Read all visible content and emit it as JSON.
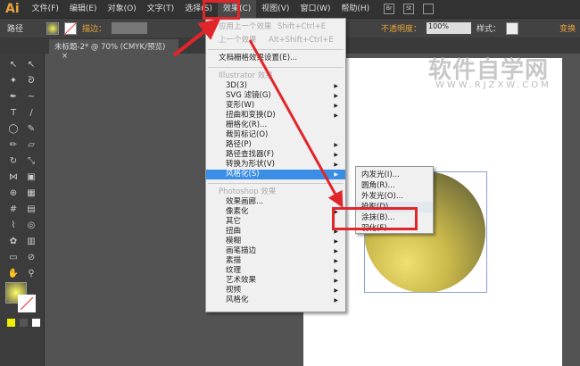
{
  "app": {
    "logo": "Ai"
  },
  "menubar": [
    "文件(F)",
    "编辑(E)",
    "对象(O)",
    "文字(T)",
    "选择(S)",
    "效果(C)",
    "视图(V)",
    "窗口(W)",
    "帮助(H)"
  ],
  "menubar_icons": [
    "Br",
    "St"
  ],
  "control": {
    "label": "路径",
    "stroke_label": "描边：",
    "opacity_label": "不透明度：",
    "opacity_value": "100%",
    "style_label": "样式：",
    "transform_label": "变换"
  },
  "tab": {
    "title": "未标题-2* @ 70% (CMYK/预览)",
    "close": "×"
  },
  "effect_menu": {
    "apply_last": "应用上一个效果",
    "apply_last_shortcut": "Shift+Ctrl+E",
    "last": "上一个效果",
    "last_shortcut": "Alt+Shift+Ctrl+E",
    "doc_raster": "文档栅格效果设置(E)...",
    "illustrator_header": "Illustrator 效果",
    "illustrator_items": [
      {
        "label": "3D(3)",
        "sub": true
      },
      {
        "label": "SVG 滤镜(G)",
        "sub": true
      },
      {
        "label": "变形(W)",
        "sub": true
      },
      {
        "label": "扭曲和变换(D)",
        "sub": true
      },
      {
        "label": "栅格化(R)...",
        "sub": false
      },
      {
        "label": "裁剪标记(O)",
        "sub": false
      },
      {
        "label": "路径(P)",
        "sub": true
      },
      {
        "label": "路径查找器(F)",
        "sub": true
      },
      {
        "label": "转换为形状(V)",
        "sub": true
      },
      {
        "label": "风格化(S)",
        "sub": true,
        "highlighted": true
      }
    ],
    "photoshop_header": "Photoshop 效果",
    "photoshop_items": [
      {
        "label": "效果画廊...",
        "sub": false
      },
      {
        "label": "像素化",
        "sub": true
      },
      {
        "label": "其它",
        "sub": false
      },
      {
        "label": "扭曲",
        "sub": true
      },
      {
        "label": "模糊",
        "sub": true
      },
      {
        "label": "画笔描边",
        "sub": true
      },
      {
        "label": "素描",
        "sub": true
      },
      {
        "label": "纹理",
        "sub": true
      },
      {
        "label": "艺术效果",
        "sub": true
      },
      {
        "label": "视频",
        "sub": true
      },
      {
        "label": "风格化",
        "sub": true
      }
    ]
  },
  "stylize_submenu": [
    "内发光(I)...",
    "圆角(R)...",
    "外发光(O)...",
    "投影(D)...",
    "涂抹(B)...",
    "羽化(F)..."
  ],
  "watermark": {
    "title": "软件自学网",
    "url": "WWW.RJZXW.COM"
  },
  "colors": {
    "accent": "#3a8ee6",
    "highlight_box": "#e0262a",
    "menubar": "#323232"
  }
}
